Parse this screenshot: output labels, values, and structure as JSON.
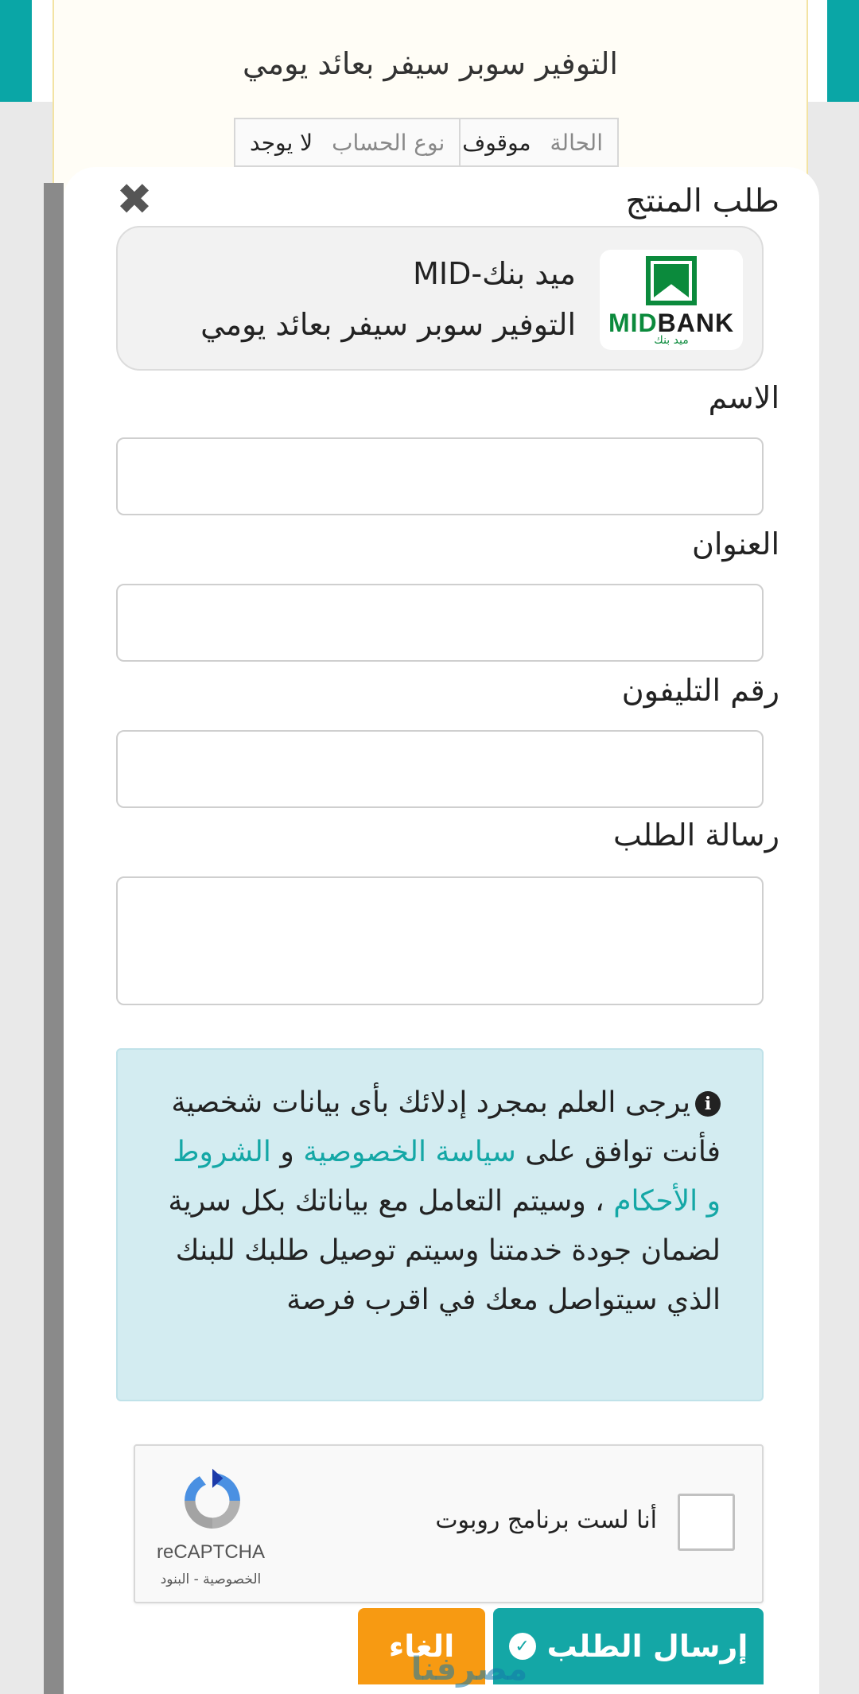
{
  "background_card": {
    "title": "التوفير سوبر سيفر بعائد يومي",
    "status_label": "الحالة",
    "status_value": "موقوف حاليا",
    "account_type_label": "نوع الحساب",
    "account_type_value": "لا يوجد"
  },
  "modal": {
    "title": "طلب المنتج",
    "close_icon": "close-icon",
    "product": {
      "bank_name": "ميد بنك-MID",
      "product_name": "التوفير سوبر سيفر بعائد يومي",
      "logo_word_green": "MID",
      "logo_word_dark": "BANK",
      "logo_sub": "ميد بنك"
    },
    "fields": {
      "name_label": "الاسم",
      "address_label": "العنوان",
      "phone_label": "رقم التليفون",
      "message_label": "رسالة الطلب"
    },
    "notice": {
      "part1": "يرجى العلم بمجرد إدلائك بأى بيانات شخصية فأنت توافق على ",
      "privacy_link": "سياسة الخصوصية",
      "and": " و ",
      "terms_link": "الشروط و الأحكام",
      "part2": " ، وسيتم التعامل مع بياناتك بكل سرية لضمان جودة خدمتنا وسيتم توصيل طلبك للبنك الذي سيتواصل معك في اقرب فرصة"
    },
    "captcha": {
      "label": "أنا لست برنامج روبوت",
      "brand": "reCAPTCHA",
      "links": "الخصوصية - البنود"
    },
    "buttons": {
      "submit": "إرسال الطلب",
      "cancel": "الغاء"
    },
    "watermark": "مصرفنا"
  },
  "colors": {
    "accent_teal": "#14a7a6",
    "cancel_orange": "#f79a12",
    "notice_bg": "#d3ecf1",
    "bank_green": "#0b8a3c"
  }
}
